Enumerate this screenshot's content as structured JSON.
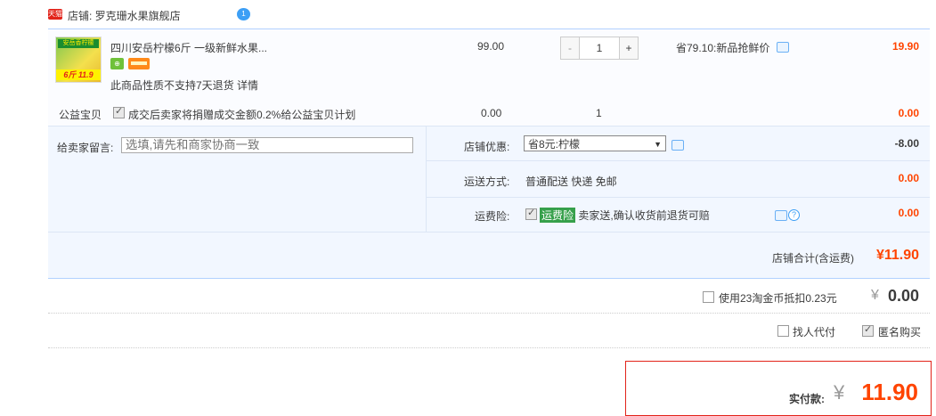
{
  "store": {
    "badge": "天猫",
    "label": "店铺: 罗克珊水果旗舰店",
    "chat_badge": "1"
  },
  "item": {
    "image_text_top": "安岳香柠檬",
    "image_text_bottom": "6斤 11.9",
    "title": "四川安岳柠檬6斤 一级新鲜水果...",
    "note": "此商品性质不支持7天退货 详情",
    "price": "99.00",
    "qty_minus": "-",
    "qty_value": "1",
    "qty_plus": "+",
    "promo": "省79.10:新品抢鲜价",
    "total": "19.90"
  },
  "charity": {
    "label": "公益宝贝",
    "text": "成交后卖家将捐赠成交金额0.2%给公益宝贝计划",
    "price": "0.00",
    "qty": "1",
    "total": "0.00"
  },
  "message": {
    "label": "给卖家留言:",
    "placeholder": "选填,请先和商家协商一致"
  },
  "discount": {
    "label": "店铺优惠:",
    "selected": "省8元:柠檬",
    "amount": "-8.00"
  },
  "shipping": {
    "label": "运送方式:",
    "value": "普通配送 快递 免邮",
    "amount": "0.00"
  },
  "insurance": {
    "label": "运费险:",
    "tag": "运费险",
    "text": "卖家送,确认收货前退货可赔",
    "amount": "0.00"
  },
  "store_total": {
    "label": "店铺合计(含运费)",
    "value": "¥11.90"
  },
  "coins": {
    "label": "使用23淘金币抵扣0.23元",
    "currency": "¥",
    "value": "0.00"
  },
  "options": {
    "proxy_label": "找人代付",
    "anonymous_label": "匿名购买"
  },
  "final": {
    "label": "实付款:",
    "currency": "¥",
    "value": "11.90"
  }
}
